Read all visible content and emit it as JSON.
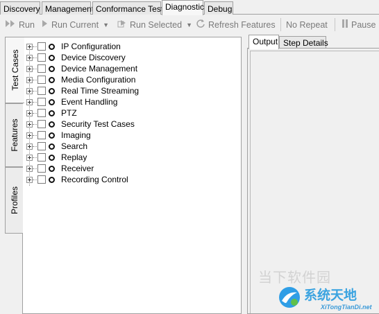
{
  "top_tabs": [
    "Discovery",
    "Management",
    "Conformance Test",
    "Diagnostic",
    "Debug"
  ],
  "toolbar": {
    "run": "Run",
    "run_current": "Run Current",
    "run_selected": "Run Selected",
    "refresh_features": "Refresh Features",
    "no_repeat": "No Repeat",
    "pause": "Pause"
  },
  "side_tabs": [
    "Test Cases",
    "Features",
    "Profiles"
  ],
  "tree_items": [
    "IP Configuration",
    "Device Discovery",
    "Device Management",
    "Media Configuration",
    "Real Time Streaming",
    "Event Handling",
    "PTZ",
    "Security Test Cases",
    "Imaging",
    "Search",
    "Replay",
    "Receiver",
    "Recording Control"
  ],
  "output_tabs": [
    "Output",
    "Step Details"
  ],
  "watermark": {
    "top": "当下软件园",
    "brand": "系统天地",
    "site": "XiTongTianDi.net"
  }
}
